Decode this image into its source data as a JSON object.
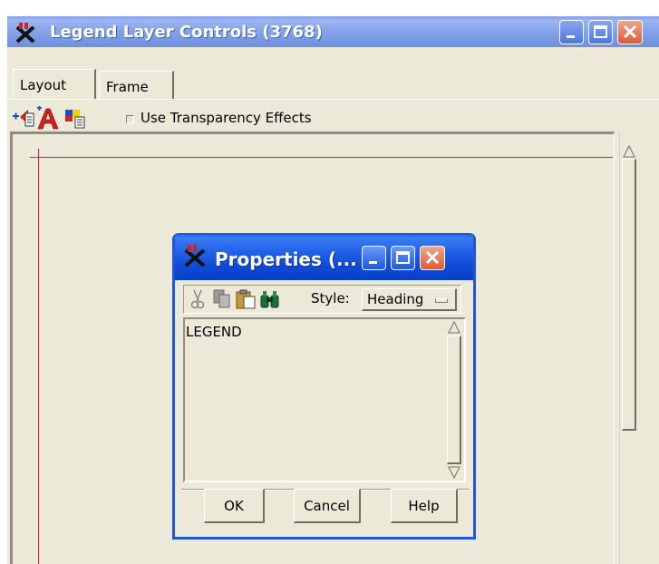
{
  "main_window": {
    "title": "Legend Layer Controls (3768)",
    "tabs": [
      {
        "label": "Layout",
        "active": true
      },
      {
        "label": "Frame",
        "active": false
      }
    ],
    "toolbar": {
      "icons": [
        "add-legend-item-icon",
        "text-style-icon",
        "color-list-icon"
      ],
      "transparency_checkbox": {
        "label": "Use Transparency Effects",
        "checked": false
      }
    },
    "caption_buttons": [
      "minimize",
      "maximize",
      "close"
    ]
  },
  "properties_dialog": {
    "title": "Properties (...",
    "toolbar": {
      "icons": [
        "cut-icon",
        "copy-icon",
        "paste-icon",
        "find-icon"
      ],
      "style_label": "Style:",
      "style_value": "Heading"
    },
    "text_content": "LEGEND",
    "buttons": {
      "ok": "OK",
      "cancel": "Cancel",
      "help": "Help"
    }
  },
  "colors": {
    "main_titlebar": "#8aa7ec",
    "dialog_titlebar": "#1f5fe6",
    "window_face": "#ece9d8",
    "guide_lines": "#e02020",
    "close_button": "#db5a3a"
  }
}
